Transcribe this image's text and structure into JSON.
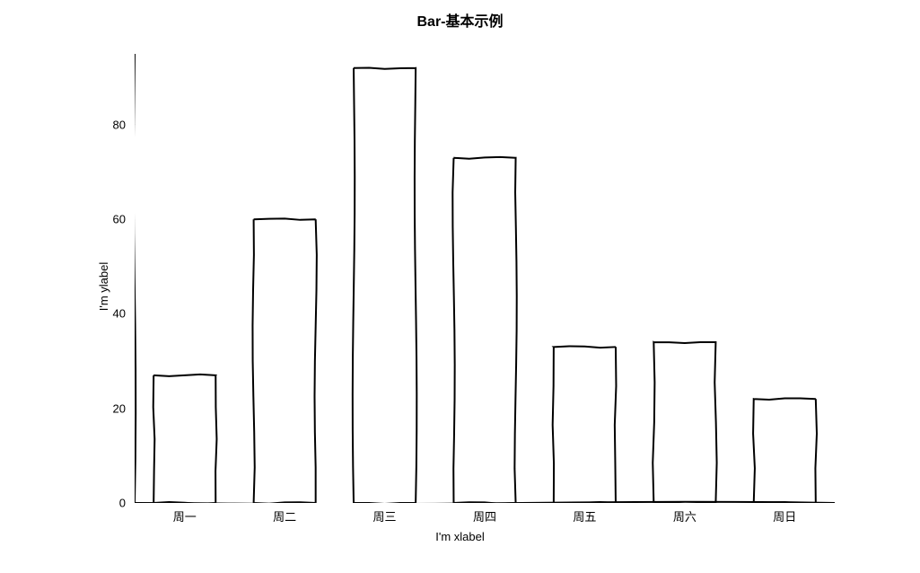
{
  "chart_data": {
    "type": "bar",
    "title": "Bar-基本示例",
    "xlabel": "I'm xlabel",
    "ylabel": "I'm ylabel",
    "categories": [
      "周一",
      "周二",
      "周三",
      "周四",
      "周五",
      "周六",
      "周日"
    ],
    "values": [
      27,
      60,
      92,
      73,
      33,
      34,
      22
    ],
    "y_ticks": [
      0,
      20,
      40,
      60,
      80
    ],
    "ylim": [
      0,
      95
    ]
  }
}
